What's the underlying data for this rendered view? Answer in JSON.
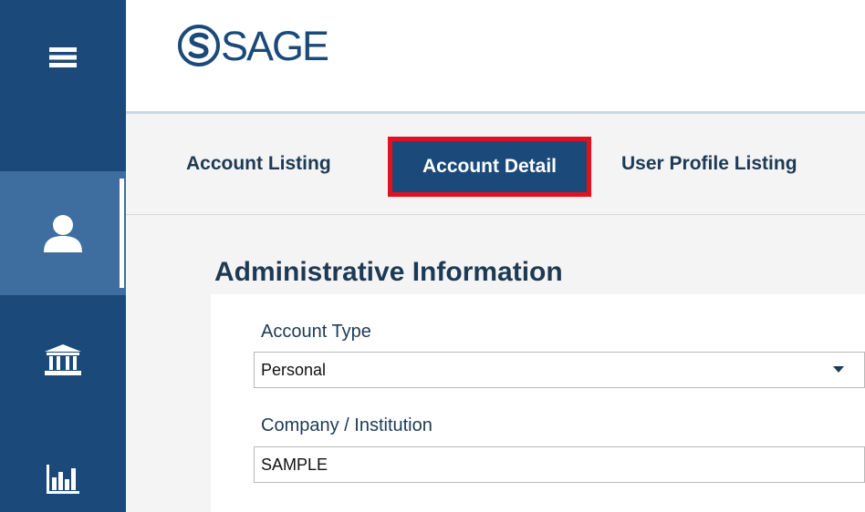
{
  "sidebar": {
    "items": [
      {
        "icon": "menu-icon"
      },
      {
        "icon": "user-icon",
        "active": true
      },
      {
        "icon": "institution-icon"
      },
      {
        "icon": "bar-chart-icon"
      }
    ]
  },
  "header": {
    "logo_text": "SAGE"
  },
  "tabs": [
    {
      "label": "Account Listing"
    },
    {
      "label": "Account Detail",
      "active": true
    },
    {
      "label": "User Profile Listing"
    }
  ],
  "section": {
    "title": "Administrative Information",
    "fields": {
      "account_type": {
        "label": "Account Type",
        "value": "Personal"
      },
      "company": {
        "label": "Company / Institution",
        "value": "SAMPLE"
      }
    }
  },
  "colors": {
    "sidebar": "#1b4a7a",
    "sidebar_active": "#3e6e9f",
    "highlight_border": "#e3111b",
    "brand": "#1b4a7a"
  }
}
